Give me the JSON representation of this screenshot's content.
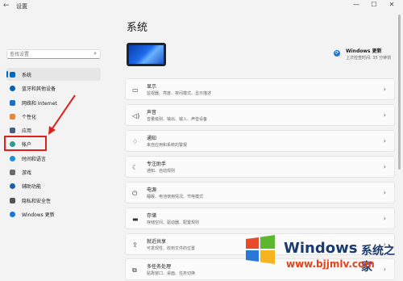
{
  "window": {
    "back_glyph": "←",
    "title": "设置",
    "min_glyph": "—",
    "max_glyph": "☐",
    "close_glyph": "✕"
  },
  "search": {
    "placeholder": "查找设置",
    "icon": "search-icon"
  },
  "sidebar": {
    "items": [
      {
        "label": "系统",
        "icon": "system-icon",
        "color": "#0067c0",
        "active": true
      },
      {
        "label": "蓝牙和其他设备",
        "icon": "bluetooth-icon",
        "color": "#0a5fb5"
      },
      {
        "label": "网络和 Internet",
        "icon": "network-icon",
        "color": "#1d6fc4"
      },
      {
        "label": "个性化",
        "icon": "personalization-icon",
        "color": "#e8893a"
      },
      {
        "label": "应用",
        "icon": "apps-icon",
        "color": "#4a5d7c"
      },
      {
        "label": "帐户",
        "icon": "account-icon",
        "color": "#2a9d8f"
      },
      {
        "label": "时间和语言",
        "icon": "time-language-icon",
        "color": "#1c8fd6"
      },
      {
        "label": "游戏",
        "icon": "gaming-icon",
        "color": "#6c6c6c"
      },
      {
        "label": "辅助功能",
        "icon": "accessibility-icon",
        "color": "#1f5fa8"
      },
      {
        "label": "隐私和安全性",
        "icon": "privacy-icon",
        "color": "#555555"
      },
      {
        "label": "Windows 更新",
        "icon": "windows-update-icon",
        "color": "#1a78d4"
      }
    ]
  },
  "main": {
    "title": "系统",
    "update": {
      "title": "Windows 更新",
      "subtitle": "上次检查时间: 35 分钟前",
      "icon": "refresh-icon"
    },
    "cards": [
      {
        "title": "显示",
        "subtitle": "监视器、亮度、夜间模式、显示描述",
        "icon": "display-icon",
        "glyph": "▭"
      },
      {
        "title": "声音",
        "subtitle": "音量级别、输出、输入、声音设备",
        "icon": "sound-icon",
        "glyph": "◁)"
      },
      {
        "title": "通知",
        "subtitle": "来自应用和系统的警报",
        "icon": "notification-icon",
        "glyph": "♢"
      },
      {
        "title": "专注助手",
        "subtitle": "通知、自动规则",
        "icon": "focus-assist-icon",
        "glyph": "☾"
      },
      {
        "title": "电源",
        "subtitle": "睡眠、电池使用情况、节电模式",
        "icon": "power-icon",
        "glyph": "⏻"
      },
      {
        "title": "存储",
        "subtitle": "存储空间、驱动器、配置规则",
        "icon": "storage-icon",
        "glyph": "▬"
      },
      {
        "title": "就近共享",
        "subtitle": "可发现性、收到文件的位置",
        "icon": "nearby-sharing-icon",
        "glyph": "⇪"
      },
      {
        "title": "多任务处理",
        "subtitle": "贴靠窗口、桌面、任务切换",
        "icon": "multitasking-icon",
        "glyph": "⧉"
      }
    ],
    "chevron": "›"
  },
  "watermark": {
    "brand": "Windows",
    "tagline": "系统之家",
    "url": "www.bjjmlv.com"
  },
  "annotation": {
    "color": "#e0211b"
  }
}
